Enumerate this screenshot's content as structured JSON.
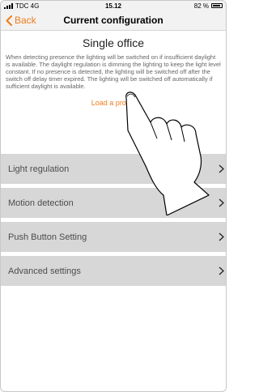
{
  "status": {
    "carrier": "TDC 4G",
    "time": "15.12",
    "battery": "82 %"
  },
  "nav": {
    "back_label": "Back",
    "title": "Current configuration"
  },
  "main": {
    "heading": "Single office",
    "description": "When detecting presence the lighting will be switched on if insufficient daylight is available. The daylight regulation is dimming the lighting to keep the light level constant. If no presence is detected, the lighting will be switched off after the switch off delay timer expired. The lighting will be switched off automatically if sufficient daylight is available.",
    "load_profile_label": "Load a profile"
  },
  "menu": [
    {
      "label": "Light regulation"
    },
    {
      "label": "Motion detection"
    },
    {
      "label": "Push Button Setting"
    },
    {
      "label": "Advanced settings"
    }
  ],
  "colors": {
    "accent": "#f07c1a",
    "menu_bg": "#d7d7d7",
    "bar_bg": "#f2f2f2"
  },
  "icons": {
    "back": "chevron-left-icon",
    "menu": "chevron-right-icon",
    "signal": "signal-icon",
    "battery": "battery-icon",
    "pointer": "hand-pointer-icon"
  }
}
